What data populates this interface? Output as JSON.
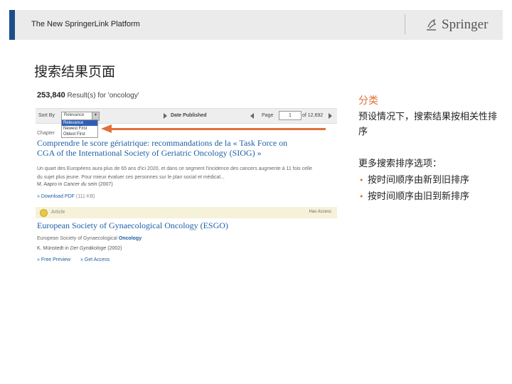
{
  "header": {
    "title": "The New SpringerLink Platform",
    "logo_text": "Springer",
    "accent_color": "#1d4e89"
  },
  "page_heading": "搜索结果页面",
  "screenshot": {
    "result_count_number": "253,840",
    "result_count_text": "Result(s) for 'oncology'",
    "sort_by_label": "Sort By",
    "sort_select_value": "Relevance",
    "sort_options": [
      "Relevance",
      "Newest First",
      "Oldest First"
    ],
    "date_published_label": "Date Published",
    "page_label": "Page",
    "page_value": "1",
    "page_of": "of 12,692",
    "chapter_label": "Chapter",
    "result1": {
      "title": "Comprendre le score gériatrique: recommandations de la « Task Force on CGA of the International Society of Geriatric Oncology (SIOG) »",
      "snippet": "Un quart des Européens aura plus de 65 ans d'ici 2020, et dans ce segment l'incidence des cancers augmente à 11 fois celle du sujet plus jeune. Pour mieux évaluer ces personnes sur le plan social et médical...",
      "author": "M. Aapro in",
      "journal": "Cancer du sein",
      "year": "(2007)",
      "download_label": "» Download PDF",
      "download_size": "(111 KB)"
    },
    "article_label": "Article",
    "access_label": "Has Access",
    "result2": {
      "title": "European Society of Gynaecological Oncology (ESGO)",
      "desc_prefix": "European Society of Gynaecological",
      "desc_highlight": "Oncology",
      "author": "K. Münstedt in",
      "journal": "Der Gynäkologe",
      "year": "(2002)",
      "preview_label": "» Free Preview",
      "access_link": "» Get Access"
    }
  },
  "annotations": {
    "heading": "分类",
    "description": "预设情况下，搜索结果按相关性排序",
    "more_options_label": "更多搜索排序选项：",
    "options": [
      "按时间顺序由新到旧排序",
      "按时间顺序由旧到新排序"
    ],
    "accent_color": "#e2703a"
  }
}
